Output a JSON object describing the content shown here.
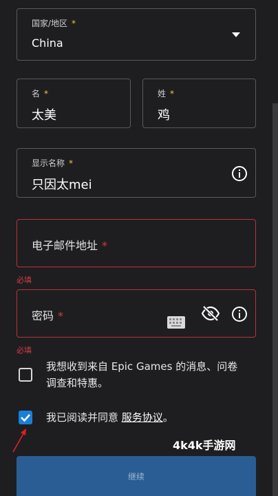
{
  "country": {
    "label": "国家/地区",
    "required_mark": "*",
    "value": "China"
  },
  "first_name": {
    "label": "名",
    "required_mark": "*",
    "value": "太美"
  },
  "last_name": {
    "label": "姓",
    "required_mark": "*",
    "value": "鸡"
  },
  "display_name": {
    "label": "显示名称",
    "required_mark": "*",
    "value": "只因太mei"
  },
  "email": {
    "label": "电子邮件地址",
    "required_mark": "*",
    "error": "必填"
  },
  "password": {
    "label": "密码",
    "required_mark": "*",
    "error": "必填"
  },
  "marketing": {
    "text_line1": "我想收到来自 Epic Games 的消息、问卷",
    "text_line2": "调查和特惠。",
    "checked": false
  },
  "terms": {
    "text": "我已阅读并同意 ",
    "link": "服务协议",
    "suffix": "。",
    "checked": true
  },
  "continue_button": {
    "label": "继续"
  },
  "watermark": "4k4k手游网",
  "colors": {
    "accent": "#1a7fd9",
    "error": "#d83a44",
    "required": "#f5c23a",
    "button": "#2a5d93"
  }
}
